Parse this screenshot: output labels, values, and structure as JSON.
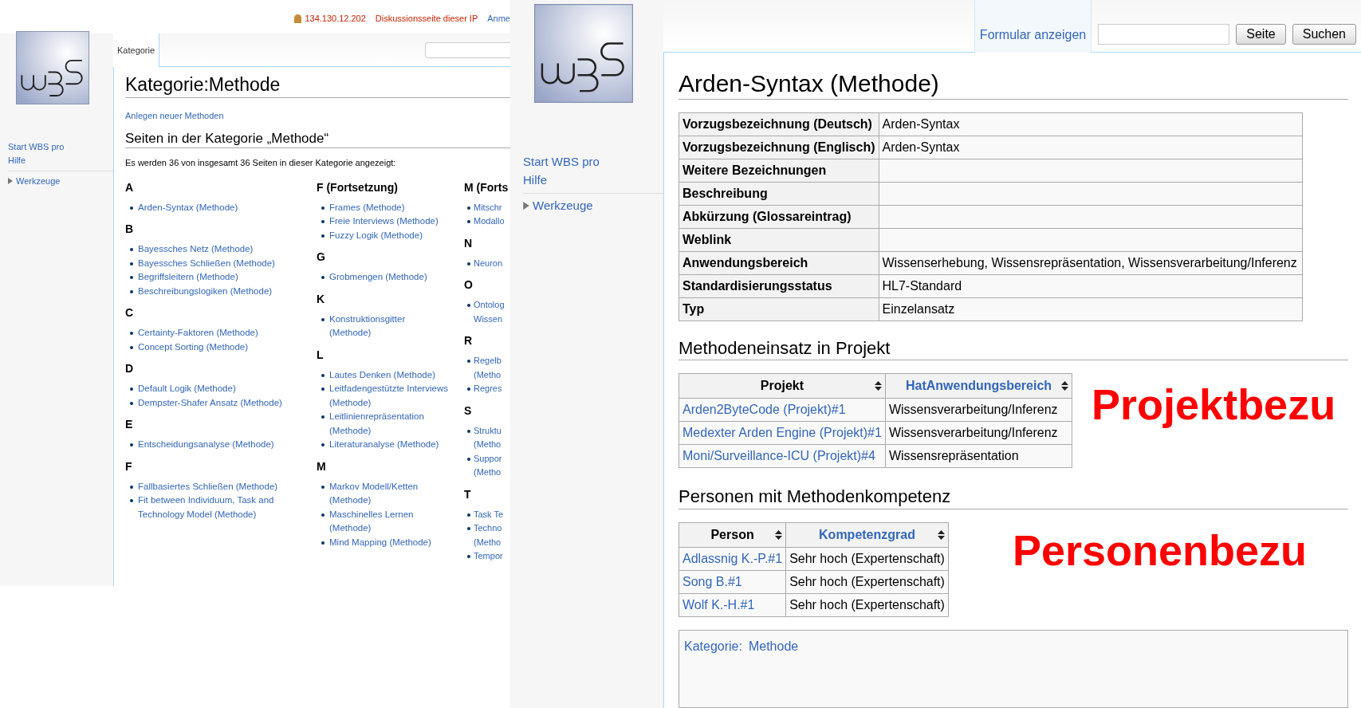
{
  "left_screenshot": {
    "user_bar": {
      "ip": "134.130.12.202",
      "talk_link": "Diskussionsseite dieser IP",
      "login_link": "Anme"
    },
    "sidebar": {
      "items": [
        {
          "label": "Start WBS pro"
        },
        {
          "label": "Hilfe"
        }
      ],
      "tools": {
        "label": "Werkzeuge",
        "expanded": false
      }
    },
    "tabs": [
      {
        "label": "Kategorie",
        "selected": true
      }
    ],
    "title": "Kategorie:Methode",
    "create_link": "Anlegen neuer Methoden",
    "section_title": "Seiten in der Kategorie „Methode“",
    "count_text": "Es werden 36 von insgesamt 36 Seiten in dieser Kategorie angezeigt:",
    "columns": [
      {
        "groups": [
          {
            "letter": "A",
            "items": [
              "Arden-Syntax (Methode)"
            ]
          },
          {
            "letter": "B",
            "items": [
              "Bayessches Netz (Methode)",
              "Bayessches Schließen (Methode)",
              "Begriffsleitern (Methode)",
              "Beschreibungslogiken (Methode)"
            ]
          },
          {
            "letter": "C",
            "items": [
              "Certainty-Faktoren (Methode)",
              "Concept Sorting (Methode)"
            ]
          },
          {
            "letter": "D",
            "items": [
              "Default Logik (Methode)",
              "Dempster-Shafer Ansatz (Methode)"
            ]
          },
          {
            "letter": "E",
            "items": [
              "Entscheidungsanalyse (Methode)"
            ]
          },
          {
            "letter": "F",
            "items": [
              "Fallbasiertes Schließen (Methode)",
              "Fit between Individuum, Task and Technology Model (Methode)"
            ]
          }
        ]
      },
      {
        "groups": [
          {
            "letter": "F (Fortsetzung)",
            "items": [
              "Frames (Methode)",
              "Freie Interviews (Methode)",
              "Fuzzy Logik (Methode)"
            ]
          },
          {
            "letter": "G",
            "items": [
              "Grobmengen (Methode)"
            ]
          },
          {
            "letter": "K",
            "items": [
              "Konstruktionsgitter (Methode)"
            ]
          },
          {
            "letter": "L",
            "items": [
              "Lautes Denken (Methode)",
              "Leitfadengestützte Interviews (Methode)",
              "Leitlinienrepräsentation (Methode)",
              "Literaturanalyse (Methode)"
            ]
          },
          {
            "letter": "M",
            "items": [
              "Markov Modell/Ketten (Methode)",
              "Maschinelles Lernen (Methode)",
              "Mind Mapping (Methode)"
            ]
          }
        ]
      },
      {
        "groups": [
          {
            "letter": "M (Forts",
            "items": [
              "Mitschr",
              "Modallo"
            ]
          },
          {
            "letter": "N",
            "items": [
              "Neuron"
            ]
          },
          {
            "letter": "O",
            "items": [
              "Ontolog Wissen"
            ]
          },
          {
            "letter": "R",
            "items": [
              "Regelb (Metho",
              "Regres"
            ]
          },
          {
            "letter": "S",
            "items": [
              "Struktu (Metho",
              "Suppor (Metho"
            ]
          },
          {
            "letter": "T",
            "items": [
              "Task Te",
              "Techno (Metho",
              "Tempor"
            ]
          }
        ]
      }
    ]
  },
  "right_screenshot": {
    "sidebar": {
      "items": [
        {
          "label": "Start WBS pro"
        },
        {
          "label": "Hilfe"
        }
      ],
      "tools": {
        "label": "Werkzeuge",
        "expanded": false
      }
    },
    "tabs": [
      {
        "label": "Formular anzeigen",
        "selected": false
      }
    ],
    "search_buttons": [
      "Seite",
      "Suchen"
    ],
    "title": "Arden-Syntax (Methode)",
    "infobox": [
      {
        "label": "Vorzugsbezeichnung (Deutsch)",
        "value": "Arden-Syntax"
      },
      {
        "label": "Vorzugsbezeichnung (Englisch)",
        "value": "Arden-Syntax"
      },
      {
        "label": "Weitere Bezeichnungen"
      },
      {
        "label": "Beschreibung"
      },
      {
        "label": "Abkürzung (Glossareintrag)"
      },
      {
        "label": "Weblink"
      },
      {
        "label": "Anwendungsbereich",
        "value": "Wissenserhebung, Wissensrepräsentation, Wissensverarbeitung/Inferenz"
      },
      {
        "label": "Standardisierungsstatus",
        "value": "HL7-Standard"
      },
      {
        "label": "Typ",
        "value": "Einzelansatz"
      }
    ],
    "sections": [
      {
        "title": "Methodeneinsatz in Projekt",
        "annotation": "Projektbezu",
        "columns": [
          {
            "label": "Projekt",
            "link": false
          },
          {
            "label": "HatAnwendungsbereich",
            "link": true
          }
        ],
        "rows": [
          [
            "Arden2ByteCode (Projekt)#1",
            "Wissensverarbeitung/Inferenz"
          ],
          [
            "Medexter Arden Engine (Projekt)#1",
            "Wissensverarbeitung/Inferenz"
          ],
          [
            "Moni/Surveillance-ICU (Projekt)#4",
            "Wissensrepräsentation"
          ]
        ]
      },
      {
        "title": "Personen mit Methodenkompetenz",
        "annotation": "Personenbezu",
        "columns": [
          {
            "label": "Person",
            "link": false
          },
          {
            "label": "Kompetenzgrad",
            "link": true
          }
        ],
        "rows": [
          [
            "Adlassnig K.-P.#1",
            "Sehr hoch (Expertenschaft)"
          ],
          [
            "Song B.#1",
            "Sehr hoch (Expertenschaft)"
          ],
          [
            "Wolf K.-H.#1",
            "Sehr hoch (Expertenschaft)"
          ]
        ]
      }
    ],
    "categories": {
      "label": "Kategorie:",
      "items": [
        "Methode"
      ]
    }
  }
}
